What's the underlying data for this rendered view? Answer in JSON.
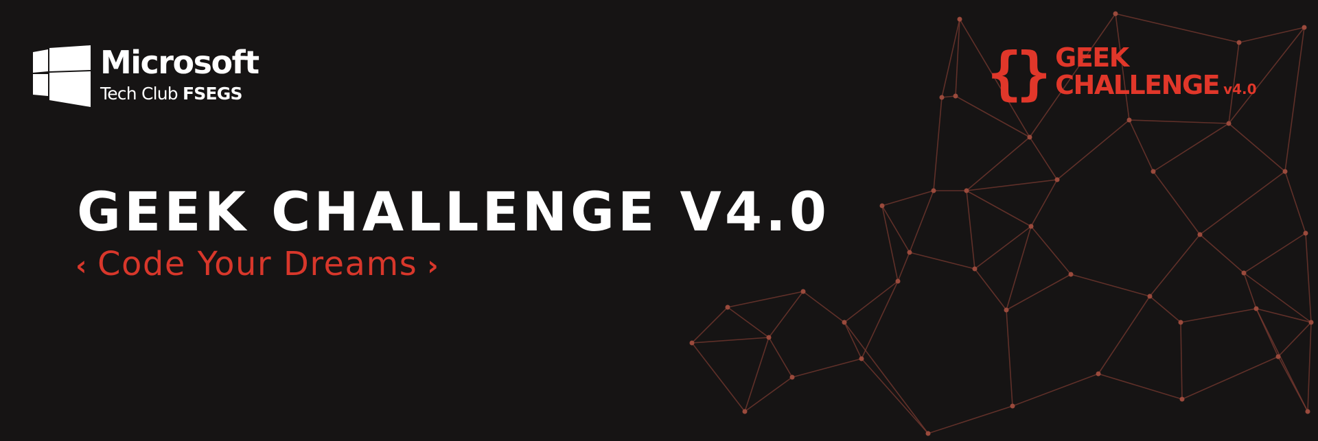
{
  "microsoft_logo": {
    "name": "Microsoft",
    "sub_regular": "Tech Club",
    "sub_bold": "FSEGS"
  },
  "geek_logo": {
    "brace": "{}",
    "line1": "GEEK",
    "line2": "CHALLENGE",
    "version": "v4.0"
  },
  "headline": "GEEK CHALLENGE V4.0",
  "tagline": {
    "left_chevron": "‹",
    "text": "Code Your Dreams",
    "right_chevron": "›"
  },
  "colors": {
    "background": "#161414",
    "accent": "#e1372a",
    "text": "#ffffff",
    "network_line": "#6b2e26"
  },
  "icons": [
    "windows-logo-icon",
    "curly-braces-icon"
  ]
}
